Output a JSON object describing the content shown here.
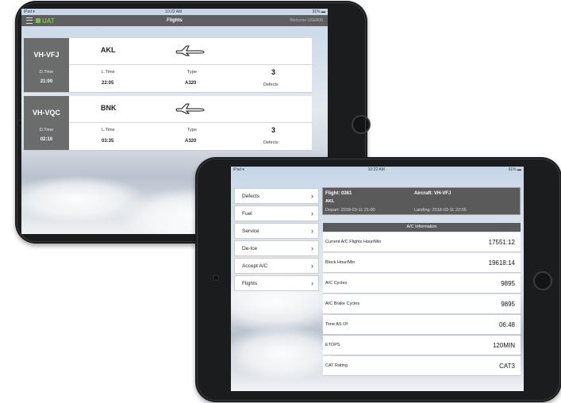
{
  "device1": {
    "status": {
      "left": "iPad ▾",
      "time": "10:22 AM",
      "battery": "91% ▬"
    },
    "navbar": {
      "logo": "UAT",
      "title": "Flights",
      "welcome": "Welcome USER06"
    },
    "flights": [
      {
        "reg": "VH-VFJ",
        "dtime_label": "D.Time",
        "dtime": "21:00",
        "dest": "AKL",
        "ltime_label": "L.Time",
        "ltime": "22:05",
        "type_label": "Type",
        "type": "A320",
        "defects_count": "3",
        "defects_label": "Defects"
      },
      {
        "reg": "VH-VQC",
        "dtime_label": "D.Time",
        "dtime": "02:10",
        "dest": "BNK",
        "ltime_label": "L.Time",
        "ltime": "03:35",
        "type_label": "Type",
        "type": "A320",
        "defects_count": "3",
        "defects_label": "Defects"
      }
    ]
  },
  "device2": {
    "status": {
      "left": "iPad ▾",
      "time": "10:22 AM",
      "battery": "91% ▬"
    },
    "menu": [
      {
        "label": "Defects"
      },
      {
        "label": "Fuel"
      },
      {
        "label": "Service"
      },
      {
        "label": "De-Ice"
      },
      {
        "label": "Accept A/C"
      },
      {
        "label": "Flights"
      }
    ],
    "flight_header": {
      "flight": "Flight: 0261",
      "aircraft": "Aircraft: VH-VFJ",
      "dest": "AKL",
      "depart": "Depart: 2018-03-11 21:00",
      "landing": "Landing: 2018-03-11 22:05"
    },
    "ac_info_title": "A/C Information",
    "ac_info": [
      {
        "key": "Current A/C Flights Hour/Min",
        "value": "17551:12"
      },
      {
        "key": "Block Hour/Min",
        "value": "19618:14"
      },
      {
        "key": "A/C Cycles",
        "value": "9895"
      },
      {
        "key": "A/C Brake Cycles",
        "value": "9895"
      },
      {
        "key": "Time AS Of",
        "value": "06:48"
      },
      {
        "key": "ETOPS",
        "value": "120MIN"
      },
      {
        "key": "CAT Rating",
        "value": "CAT3"
      }
    ]
  }
}
